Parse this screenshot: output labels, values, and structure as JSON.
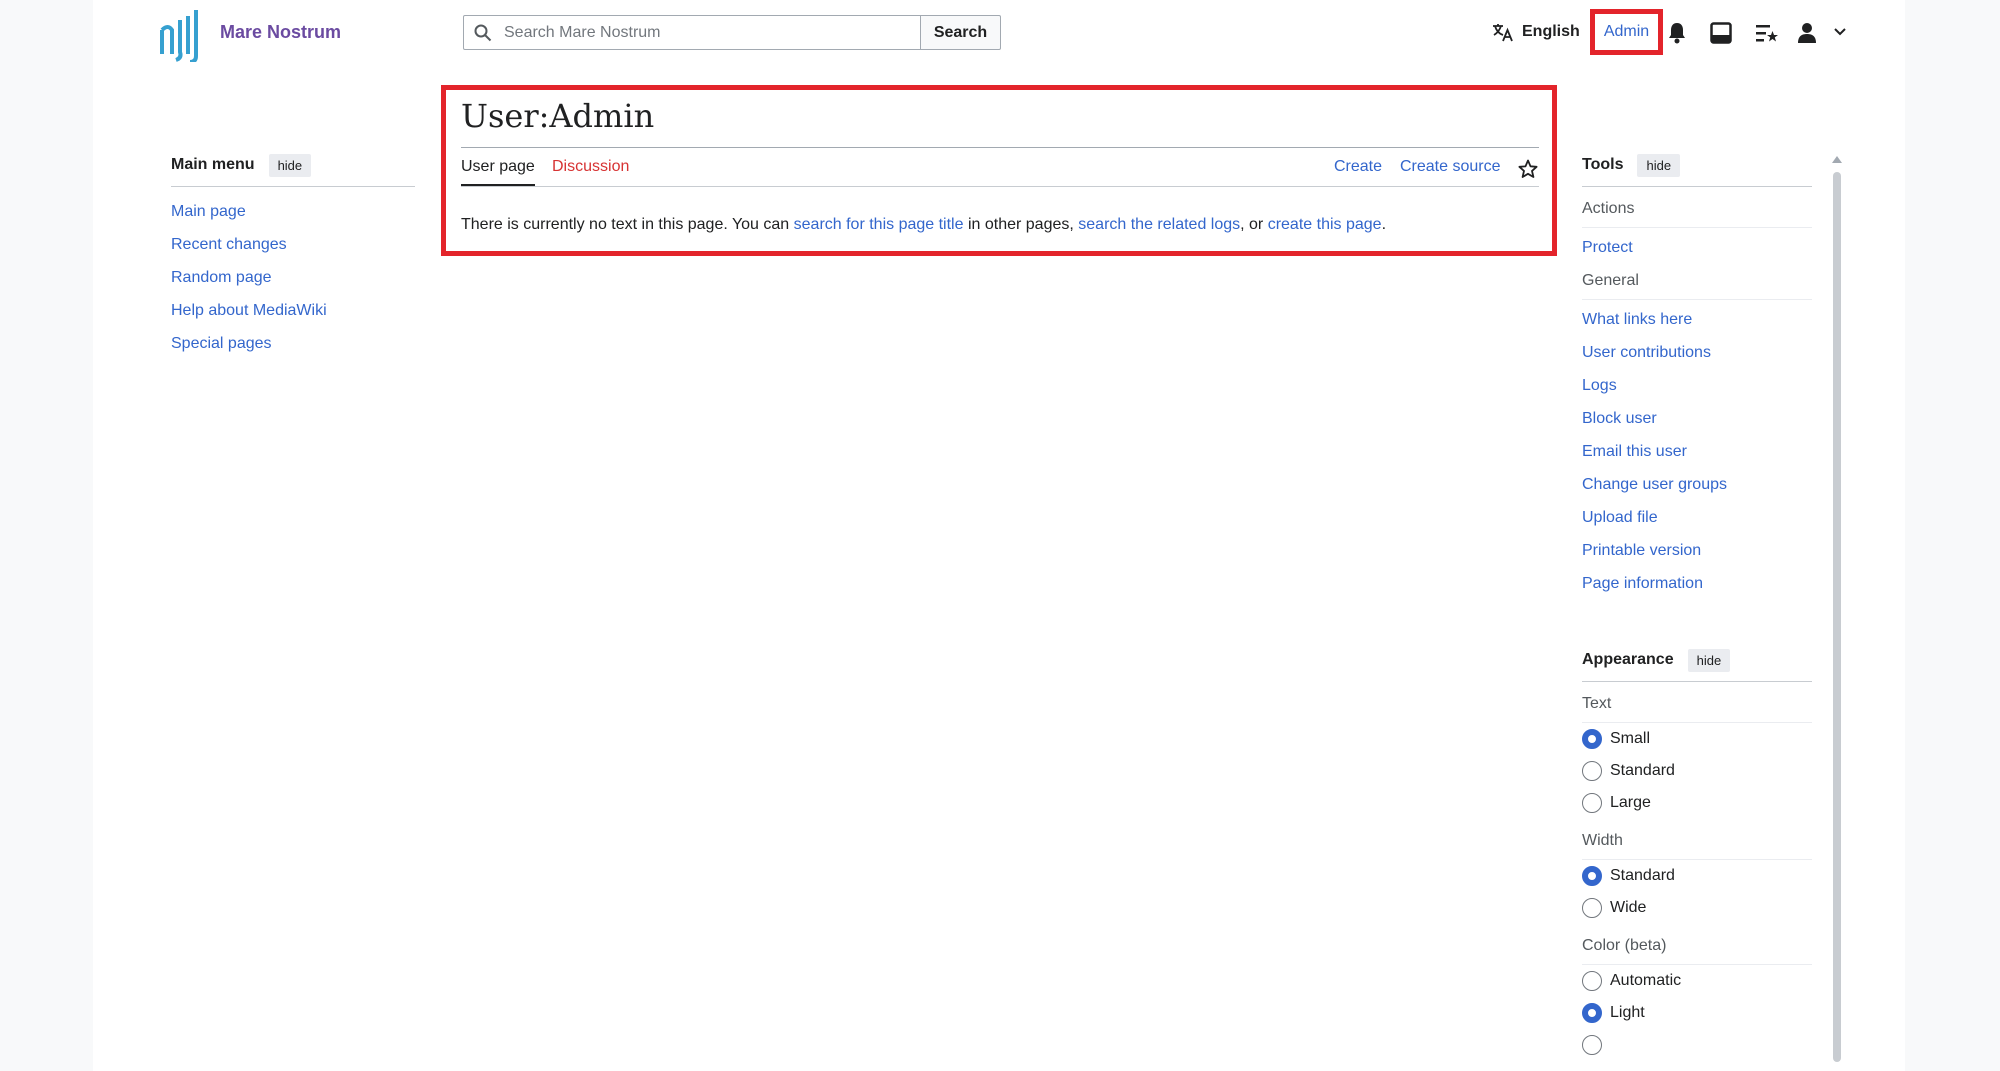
{
  "header": {
    "site_name": "Mare Nostrum",
    "search_placeholder": "Search Mare Nostrum",
    "search_button": "Search",
    "language": "English",
    "user": "Admin"
  },
  "left_menu": {
    "title": "Main menu",
    "hide": "hide",
    "items": [
      "Main page",
      "Recent changes",
      "Random page",
      "Help about MediaWiki",
      "Special pages"
    ]
  },
  "main": {
    "title": "User:Admin",
    "tabs": {
      "user_page": "User page",
      "discussion": "Discussion",
      "create": "Create",
      "create_source": "Create source"
    },
    "notice": {
      "t1": "There is currently no text in this page. You can ",
      "l1": "search for this page title",
      "t2": " in other pages, ",
      "l2": "search the related logs",
      "t3": ", or ",
      "l3": "create this page",
      "t4": "."
    }
  },
  "tools": {
    "title": "Tools",
    "hide": "hide",
    "actions_label": "Actions",
    "actions": [
      "Protect"
    ],
    "general_label": "General",
    "general": [
      "What links here",
      "User contributions",
      "Logs",
      "Block user",
      "Email this user",
      "Change user groups",
      "Upload file",
      "Printable version",
      "Page information"
    ]
  },
  "appearance": {
    "title": "Appearance",
    "hide": "hide",
    "text_label": "Text",
    "text_options": [
      "Small",
      "Standard",
      "Large"
    ],
    "text_selected": "Small",
    "width_label": "Width",
    "width_options": [
      "Standard",
      "Wide"
    ],
    "width_selected": "Standard",
    "color_label": "Color (beta)",
    "color_options": [
      "Automatic",
      "Light"
    ],
    "color_selected": "Light"
  },
  "colors": {
    "link": "#3366cc",
    "new_link": "#d73333",
    "highlight": "#e3242b",
    "brand": "#6b4ba1"
  }
}
